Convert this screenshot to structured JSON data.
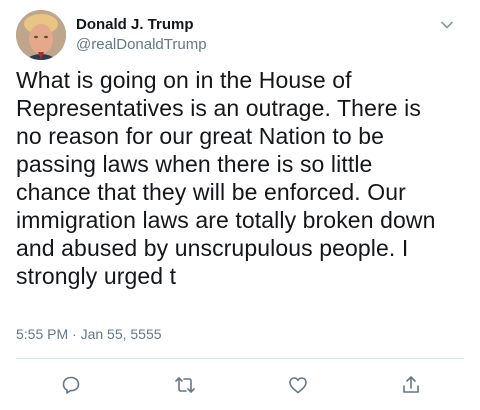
{
  "tweet": {
    "display_name": "Donald J. Trump",
    "handle": "@realDonaldTrump",
    "text": "What is going on in the House of\nRepresentatives is an outrage. There is\nno reason for our great Nation to be\npassing laws when there is so little\nchance that they will be enforced. Our\nimmigration laws are totally broken down\nand abused by unscrupulous people. I\nstrongly urged t",
    "timestamp": "5:55 PM · Jan 55, 5555"
  },
  "icons": {
    "more": "chevron-down-icon",
    "reply": "reply-icon",
    "retweet": "retweet-icon",
    "like": "heart-icon",
    "share": "share-icon"
  },
  "colors": {
    "text": "#14171a",
    "secondary": "#657786",
    "divider": "#e1e8ed"
  }
}
